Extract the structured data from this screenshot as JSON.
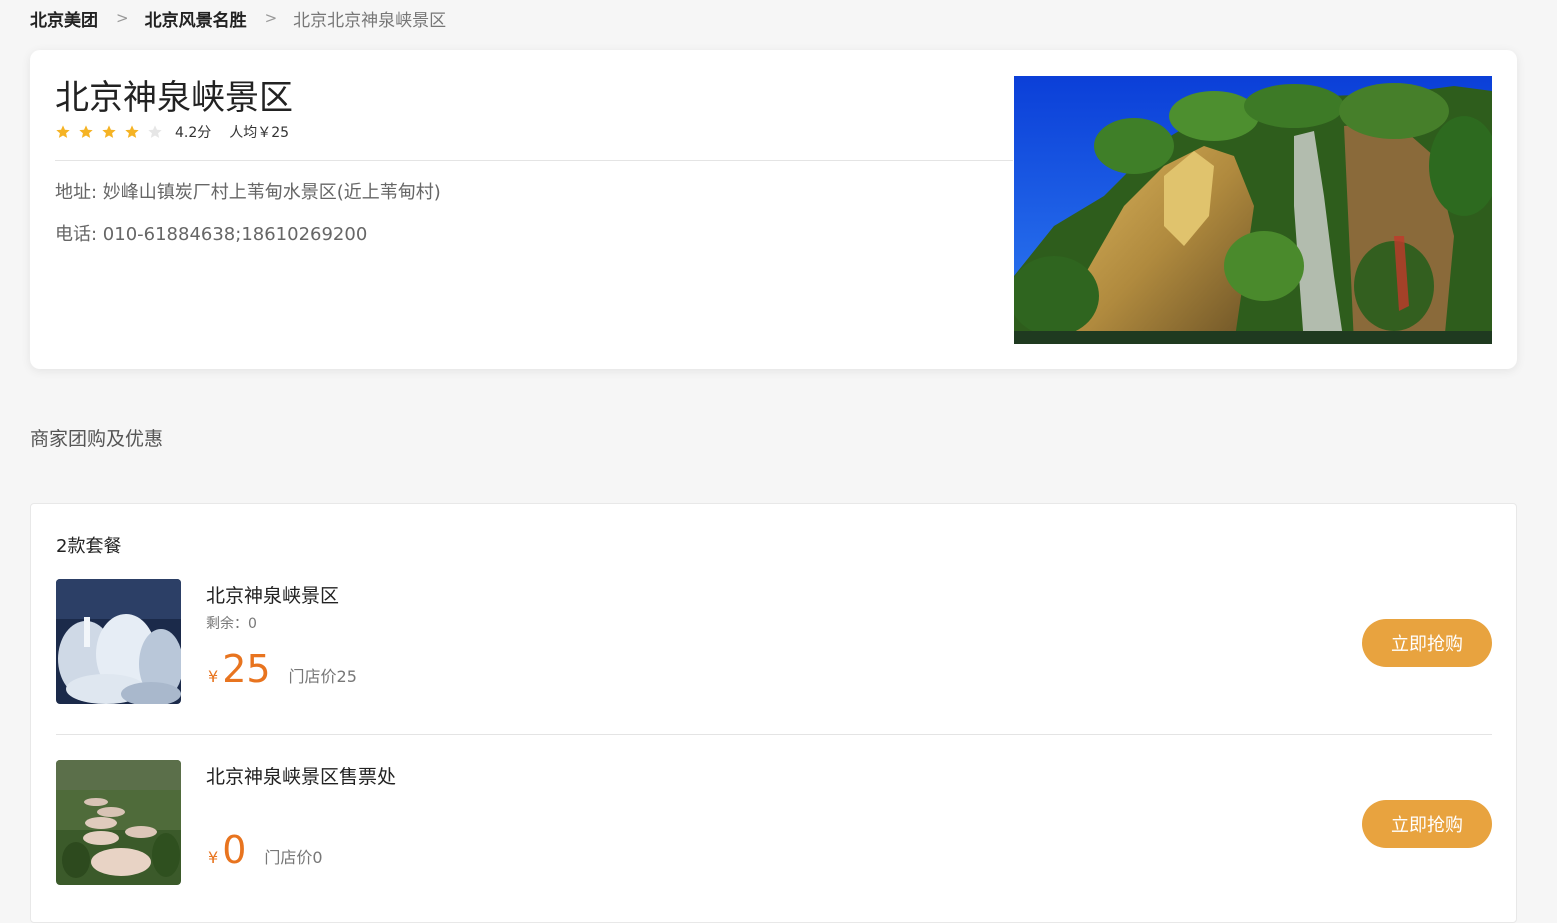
{
  "breadcrumb": {
    "items": [
      "北京美团",
      "北京风景名胜"
    ],
    "separator": ">",
    "current": "北京北京神泉峡景区"
  },
  "poi": {
    "title": "北京神泉峡景区",
    "rating": 4.2,
    "rating_text": "4.2分",
    "avg_price_text": "人均￥25",
    "address": "地址: 妙峰山镇炭厂村上苇甸水景区(近上苇甸村)",
    "phone": "电话: 010-61884638;18610269200"
  },
  "deals_section": {
    "title": "商家团购及优惠",
    "count_text": "2款套餐",
    "items": [
      {
        "name": "北京神泉峡景区",
        "remain": "剩余：0",
        "currency": "¥",
        "price": "25",
        "store_price": "门店价25",
        "button": "立即抢购"
      },
      {
        "name": "北京神泉峡景区售票处",
        "remain": "",
        "currency": "¥",
        "price": "0",
        "store_price": "门店价0",
        "button": "立即抢购"
      }
    ]
  },
  "colors": {
    "accent_orange": "#e8741f",
    "button": "#e8a33f",
    "star_filled": "#f5b324",
    "star_empty": "#e6e6e6"
  }
}
